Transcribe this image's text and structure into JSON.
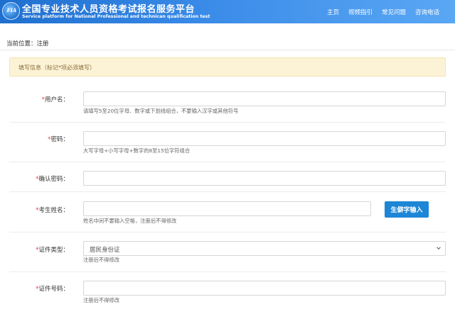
{
  "header": {
    "logo_text": "FIA",
    "title_cn": "全国专业技术人员资格考试报名服务平台",
    "title_en": "Service platform for National Professional and technican qualification test",
    "nav": [
      "主页",
      "视频指引",
      "常见问题",
      "咨询电话"
    ]
  },
  "breadcrumb": "当前位置：注册",
  "notice": "填写信息（标记*项必须填写）",
  "form": {
    "username": {
      "label": "用户名：",
      "hint": "请填写5至20位字母、数字或下划线组合，不要输入汉字或其他符号",
      "value": ""
    },
    "password": {
      "label": "密码：",
      "hint": "大写字母+小写字母+数字的8至15位字符组合",
      "value": ""
    },
    "confirm_password": {
      "label": "确认密码：",
      "value": ""
    },
    "name": {
      "label": "考生姓名：",
      "hint": "姓名中间不要输入空格，注册后不得修改",
      "value": "",
      "rare_char_button": "生僻字输入"
    },
    "id_type": {
      "label": "证件类型：",
      "selected": "居民身份证",
      "hint": "注册后不得修改"
    },
    "id_number": {
      "label": "证件号码：",
      "hint": "注册后不得修改",
      "value": ""
    }
  },
  "colors": {
    "header": "#1f6fcf",
    "accent": "#1e86d6",
    "required": "#e0393e",
    "notice_bg": "#fcf3d6"
  }
}
